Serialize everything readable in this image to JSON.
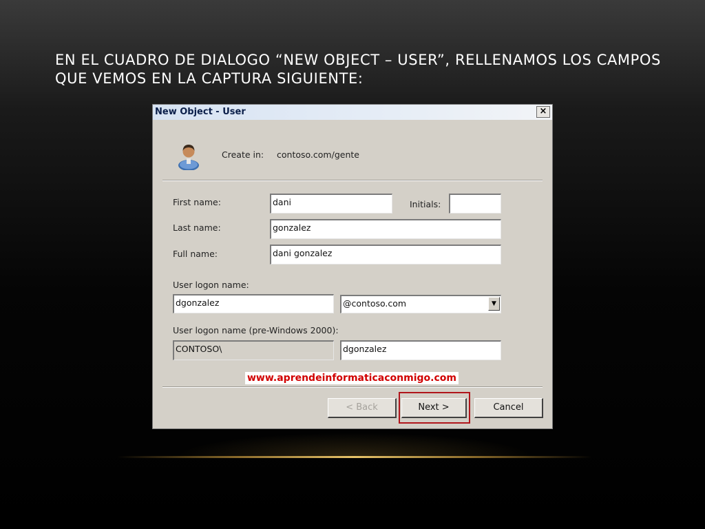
{
  "slide": {
    "title": "EN EL CUADRO DE DIALOGO “NEW OBJECT – USER”, RELLENAMOS LOS CAMPOS QUE VEMOS EN LA CAPTURA SIGUIENTE:"
  },
  "dialog": {
    "title": "New Object - User",
    "close_label": "×",
    "create_in_label": "Create in:",
    "create_in_value": "contoso.com/gente",
    "first_name_label": "First name:",
    "first_name_value": "dani",
    "initials_label": "Initials:",
    "initials_value": "",
    "last_name_label": "Last name:",
    "last_name_value": "gonzalez",
    "full_name_label": "Full name:",
    "full_name_value": "dani gonzalez",
    "logon_name_label": "User logon name:",
    "logon_name_value": "dgonzalez",
    "domain_selected": "@contoso.com",
    "pre2000_label": "User logon name (pre-Windows 2000):",
    "pre2000_domain_value": "CONTOSO\\",
    "pre2000_name_value": "dgonzalez",
    "watermark": "www.aprendeinformaticaconmigo.com",
    "back_label": "< Back",
    "next_label": "Next >",
    "cancel_label": "Cancel"
  },
  "icons": {
    "user": "user-icon",
    "dropdown": "chevron-down-icon"
  },
  "colors": {
    "highlight": "#b0151b",
    "watermark": "#d10000",
    "accent_line": "#e8c46a"
  }
}
